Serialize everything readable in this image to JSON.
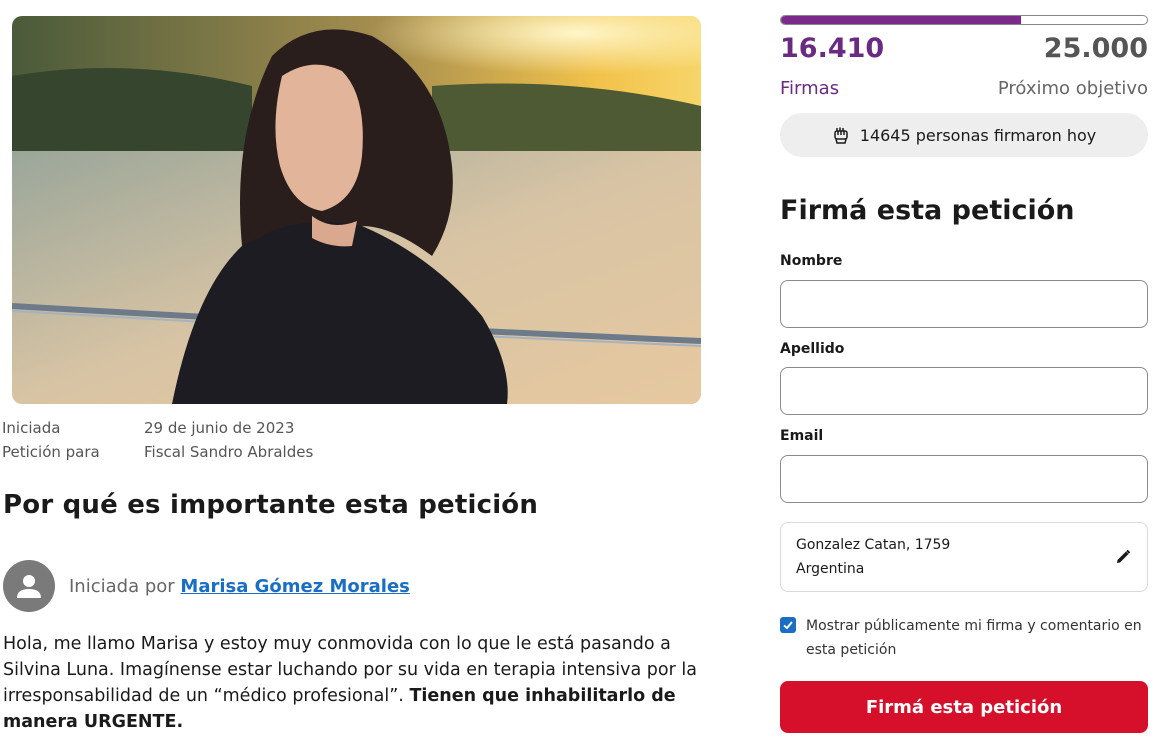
{
  "petition": {
    "started_label": "Iniciada",
    "started_date": "29 de junio de 2023",
    "target_label": "Petición para",
    "target_name": "Fiscal Sandro Abraldes",
    "section_title": "Por qué es importante esta petición",
    "started_by_prefix": "Iniciada por",
    "started_by_name": "Marisa Gómez Morales",
    "body_plain": "Hola, me llamo Marisa y estoy muy conmovida con lo que le está pasando a Silvina Luna. Imagínense estar luchando por su vida en terapia intensiva por la irresponsabilidad de un “médico profesional”. ",
    "body_bold": "Tienen que inhabilitarlo de manera URGENTE."
  },
  "stats": {
    "signatures": "16.410",
    "signatures_label": "Firmas",
    "goal": "25.000",
    "goal_label": "Próximo objetivo",
    "progress_fraction": 0.6564,
    "today_text": "14645 personas firmaron hoy"
  },
  "form": {
    "title": "Firmá esta petición",
    "first_name_label": "Nombre",
    "first_name_value": "",
    "last_name_label": "Apellido",
    "last_name_value": "",
    "email_label": "Email",
    "email_value": "",
    "location_line1": "Gonzalez Catan, 1759",
    "location_line2": "Argentina",
    "public_checkbox_label": "Mostrar públicamente mi firma y comentario en esta petición",
    "public_checked": true,
    "submit_label": "Firmá esta petición"
  },
  "icons": {
    "avatar": "person-icon",
    "today": "raised-fist-icon",
    "edit": "pencil-icon",
    "check": "check-icon"
  },
  "colors": {
    "brand_purple": "#6a2a82",
    "progress_purple": "#7b2a8c",
    "link_blue": "#1a6fc4",
    "cta_red": "#d6102a"
  }
}
